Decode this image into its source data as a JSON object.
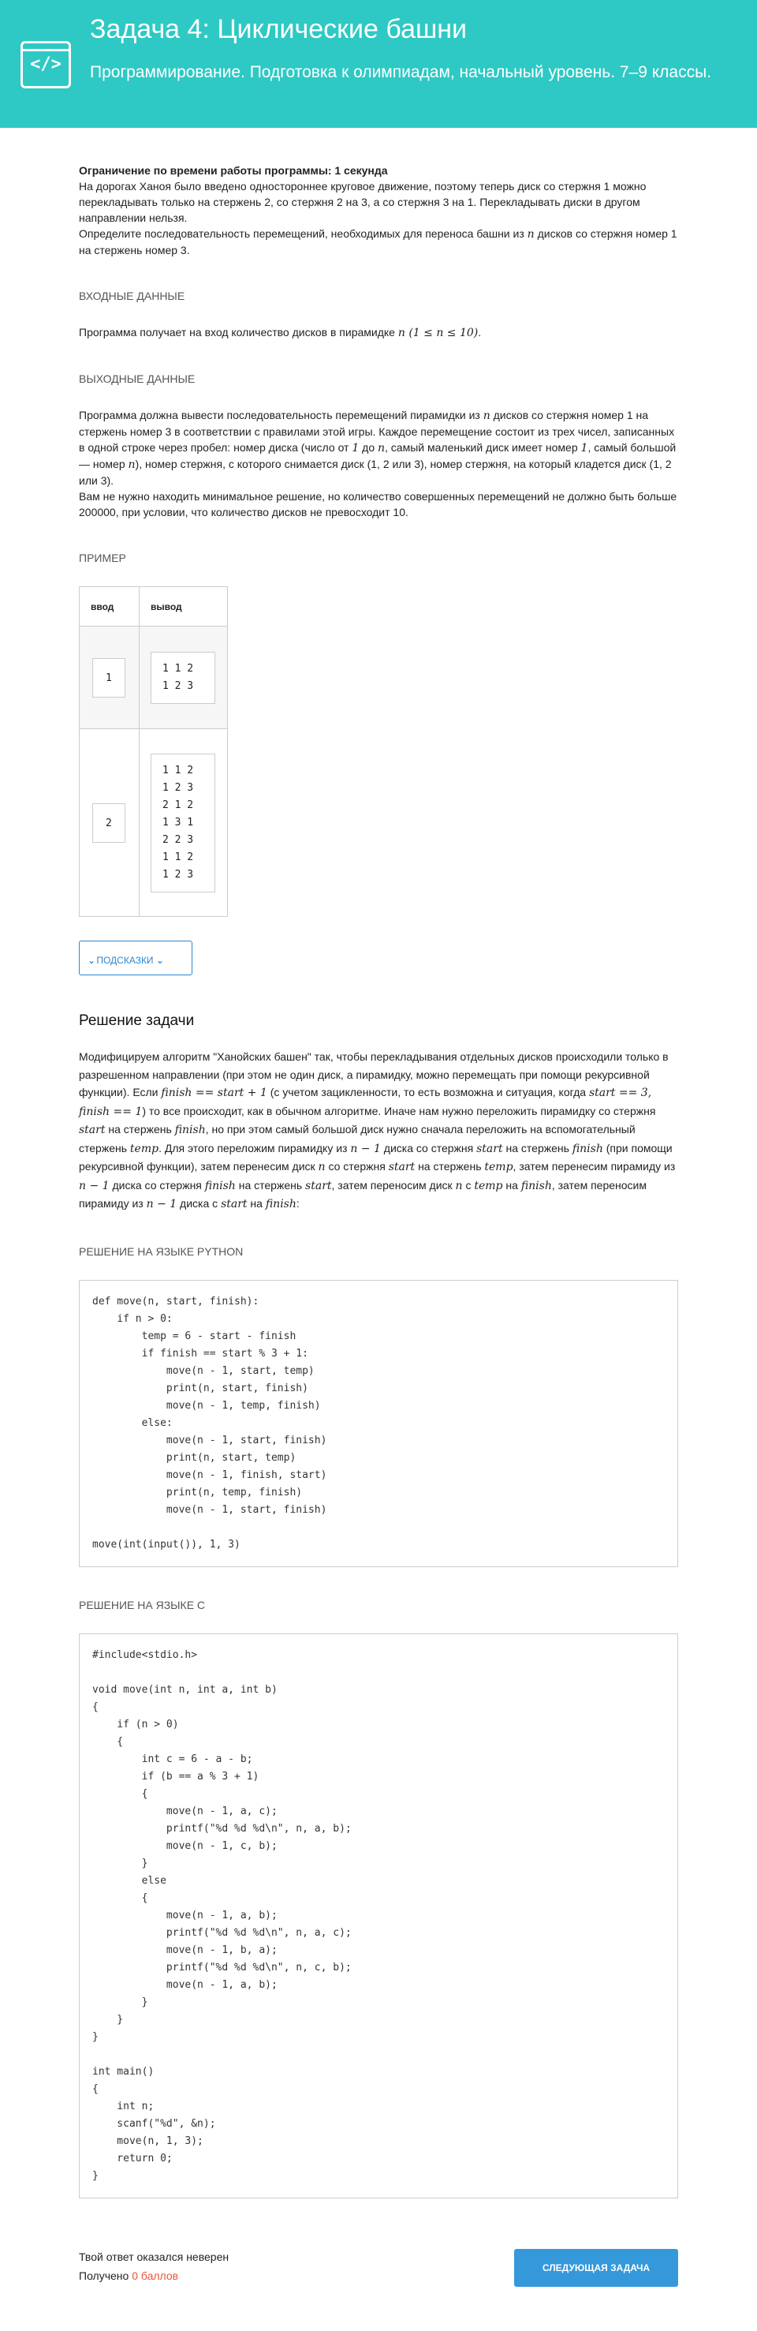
{
  "header": {
    "logo_glyph": "</>",
    "title": "Задача 4: Циклические башни",
    "subtitle": "Программирование. Подготовка к олимпиадам, начальный уровень. 7–9 классы."
  },
  "task": {
    "time_limit": "Ограничение по времени работы программы: 1 секунда",
    "statement_1": "На дорогах Ханоя было введено одностороннее круговое движение, поэтому теперь диск со стержня 1 можно перекладывать только на стержень 2, со стержня 2 на 3, а со стержня 3 на 1. Перекладывать диски в другом направлении нельзя.",
    "statement_2a": "Определите последовательность перемещений, необходимых для переноса башни из ",
    "statement_2_n": "n",
    "statement_2b": " дисков со стержня номер 1 на стержень номер 3."
  },
  "input_section": {
    "title": "ВХОДНЫЕ ДАННЫЕ",
    "text_a": "Программа получает на вход количество дисков в пирамидке ",
    "text_math": "n (1 ≤ n ≤ 10)",
    "text_b": "."
  },
  "output_section": {
    "title": "ВЫХОДНЫЕ ДАННЫЕ",
    "p1a": "Программа должна вывести последовательность перемещений пирамидки из ",
    "p1n": "n",
    "p1b": " дисков со стержня номер 1 на стержень номер 3 в соответствии с правилами этой игры. Каждое перемещение состоит из трех чисел, записанных в одной строке через пробел: номер диска (число от ",
    "p1one": "1",
    "p1c": " до ",
    "p1n2": "n",
    "p1d": ", самый маленький диск имеет номер ",
    "p1one2": "1",
    "p1e": ", самый большой — номер ",
    "p1n3": "n",
    "p1f": "), номер стержня, с которого снимается диск (1, 2 или 3), номер стержня, на который кладется диск (1, 2 или 3).",
    "p2": "Вам не нужно находить минимальное решение, но количество совершенных перемещений не должно быть больше 200000, при условии, что количество дисков не превосходит 10."
  },
  "example": {
    "title": "ПРИМЕР",
    "col_in": "ввод",
    "col_out": "вывод",
    "rows": [
      {
        "input": "1",
        "output": "1 1 2\n1 2 3"
      },
      {
        "input": "2",
        "output": "1 1 2\n1 2 3\n2 1 2\n1 3 1\n2 2 3\n1 1 2\n1 2 3"
      }
    ]
  },
  "hints_button": "ПОДСКАЗКИ",
  "solution": {
    "title": "Решение задачи",
    "t01": "Модифицируем алгоритм \"Ханойских башен\" так, чтобы перекладывания отдельных дисков происходили только в разрешенном направлении (при этом не один диск, а пирамидку, можно перемещать при помощи рекурсивной функции). Если ",
    "m01": "finish == start + 1",
    "t02": " (с учетом зацикленности, то есть возможна и ситуация, когда ",
    "m02": "start == 3, finish == 1",
    "t03": ") то все происходит, как в обычном алгоритме. Иначе нам нужно переложить пирамидку со стержня ",
    "m03": "start",
    "t04": " на стержень ",
    "m04": "finish",
    "t05": ", но при этом самый большой диск нужно сначала переложить на вспомогательный стержень ",
    "m05": "temp",
    "t06": ". Для этого переложим пирамидку из ",
    "m06": "n − 1",
    "t07": " диска со стержня ",
    "m07": "start",
    "t08": " на стержень ",
    "m08": "finish",
    "t09": " (при помощи рекурсивной функции), затем перенесим диск ",
    "m09": "n",
    "t10": " со стержня ",
    "m10": "start",
    "t11": " на стержень ",
    "m11": "temp",
    "t12": ", затем перенесим пирамиду из ",
    "m12": "n − 1",
    "t13": " диска со стержня ",
    "m13": "finish",
    "t14": " на стержень ",
    "m14": "start",
    "t15": ", затем переносим диск ",
    "m15": "n",
    "t16": " с ",
    "m16": "temp",
    "t17": " на ",
    "m17": "finish",
    "t18": ", затем переносим пирамиду из ",
    "m18": "n − 1",
    "t19": " диска с ",
    "m19": "start",
    "t20": " на ",
    "m20": "finish",
    "t21": ":"
  },
  "python": {
    "title": "РЕШЕНИЕ НА ЯЗЫКЕ PYTHON",
    "code": "def move(n, start, finish):\n    if n > 0:\n        temp = 6 - start - finish\n        if finish == start % 3 + 1:\n            move(n - 1, start, temp)\n            print(n, start, finish)\n            move(n - 1, temp, finish)\n        else:\n            move(n - 1, start, finish)\n            print(n, start, temp)\n            move(n - 1, finish, start)\n            print(n, temp, finish)\n            move(n - 1, start, finish)\n\nmove(int(input()), 1, 3)"
  },
  "c_lang": {
    "title": "РЕШЕНИЕ НА ЯЗЫКЕ C",
    "code": "#include<stdio.h>\n\nvoid move(int n, int a, int b)\n{\n    if (n > 0)\n    {\n        int c = 6 - a - b;\n        if (b == a % 3 + 1)\n        {\n            move(n - 1, a, c);\n            printf(\"%d %d %d\\n\", n, a, b);\n            move(n - 1, c, b);\n        }\n        else\n        {\n            move(n - 1, a, b);\n            printf(\"%d %d %d\\n\", n, a, c);\n            move(n - 1, b, a);\n            printf(\"%d %d %d\\n\", n, c, b);\n            move(n - 1, a, b);\n        }\n    }\n}\n\nint main()\n{\n    int n;\n    scanf(\"%d\", &n);\n    move(n, 1, 3);\n    return 0;\n}"
  },
  "result": {
    "status": "Твой ответ оказался неверен",
    "received_label": "Получено ",
    "score": "0 баллов",
    "next_button": "СЛЕДУЮЩАЯ ЗАДАЧА"
  },
  "colors": {
    "header_bg": "#2ec9c4",
    "accent_blue": "#3498db",
    "score_red": "#e8563b"
  }
}
